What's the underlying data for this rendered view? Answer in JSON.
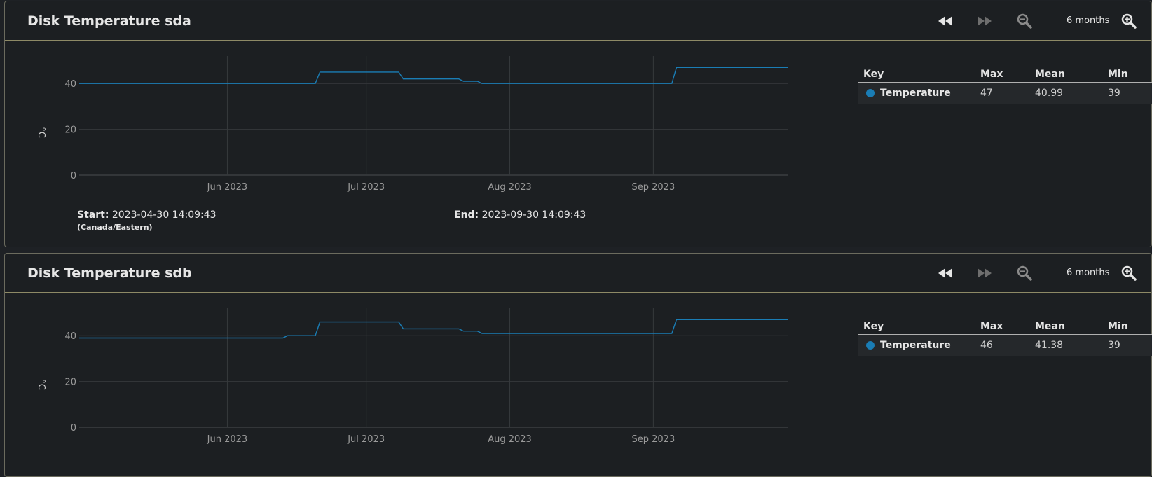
{
  "icons": {
    "rewind": "rewind-icon",
    "fast_forward": "fast-forward-icon",
    "zoom_out": "zoom-out-icon",
    "zoom_in": "zoom-in-icon"
  },
  "colors": {
    "series": "#1a7db5",
    "background": "#1c1f22",
    "header_border": "#8e8a66"
  },
  "panels": [
    {
      "title": "Disk Temperature sda",
      "range_label": "6 months",
      "legend": {
        "headers": {
          "key": "Key",
          "max": "Max",
          "mean": "Mean",
          "min": "Min"
        },
        "rows": [
          {
            "name": "Temperature",
            "max": "47",
            "mean": "40.99",
            "min": "39"
          }
        ]
      },
      "footer": {
        "start_label": "Start:",
        "start_value": "2023-04-30 14:09:43",
        "timezone": "(Canada/Eastern)",
        "end_label": "End:",
        "end_value": "2023-09-30 14:09:43"
      }
    },
    {
      "title": "Disk Temperature sdb",
      "range_label": "6 months",
      "legend": {
        "headers": {
          "key": "Key",
          "max": "Max",
          "mean": "Mean",
          "min": "Min"
        },
        "rows": [
          {
            "name": "Temperature",
            "max": "46",
            "mean": "41.38",
            "min": "39"
          }
        ]
      }
    }
  ],
  "chart_data": [
    {
      "type": "line",
      "title": "Disk Temperature sda",
      "xlabel": "",
      "ylabel": "°C",
      "xlim": [
        "2023-04-30",
        "2023-09-30"
      ],
      "ylim": [
        0,
        52
      ],
      "yticks": [
        "0",
        "20",
        "40"
      ],
      "xticks": [
        {
          "label": "Jun 2023",
          "date": "2023-06-01"
        },
        {
          "label": "Jul 2023",
          "date": "2023-07-01"
        },
        {
          "label": "Aug 2023",
          "date": "2023-08-01"
        },
        {
          "label": "Sep 2023",
          "date": "2023-09-01"
        }
      ],
      "grid": true,
      "series": [
        {
          "name": "Temperature",
          "x": [
            "2023-04-30",
            "2023-06-20",
            "2023-06-21",
            "2023-07-08",
            "2023-07-09",
            "2023-07-21",
            "2023-07-22",
            "2023-07-25",
            "2023-07-26",
            "2023-09-05",
            "2023-09-06",
            "2023-09-30"
          ],
          "y": [
            40,
            40,
            45,
            45,
            42,
            42,
            41,
            41,
            40,
            40,
            47,
            47
          ]
        }
      ]
    },
    {
      "type": "line",
      "title": "Disk Temperature sdb",
      "xlabel": "",
      "ylabel": "°C",
      "xlim": [
        "2023-04-30",
        "2023-09-30"
      ],
      "ylim": [
        0,
        52
      ],
      "yticks": [
        "0",
        "20",
        "40"
      ],
      "xticks": [
        {
          "label": "Jun 2023",
          "date": "2023-06-01"
        },
        {
          "label": "Jul 2023",
          "date": "2023-07-01"
        },
        {
          "label": "Aug 2023",
          "date": "2023-08-01"
        },
        {
          "label": "Sep 2023",
          "date": "2023-09-01"
        }
      ],
      "grid": true,
      "series": [
        {
          "name": "Temperature",
          "x": [
            "2023-04-30",
            "2023-06-13",
            "2023-06-14",
            "2023-06-20",
            "2023-06-21",
            "2023-07-08",
            "2023-07-09",
            "2023-07-21",
            "2023-07-22",
            "2023-07-25",
            "2023-07-26",
            "2023-09-05",
            "2023-09-06",
            "2023-09-30"
          ],
          "y": [
            39,
            39,
            40,
            40,
            46,
            46,
            43,
            43,
            42,
            42,
            41,
            41,
            47,
            47
          ]
        }
      ]
    }
  ]
}
